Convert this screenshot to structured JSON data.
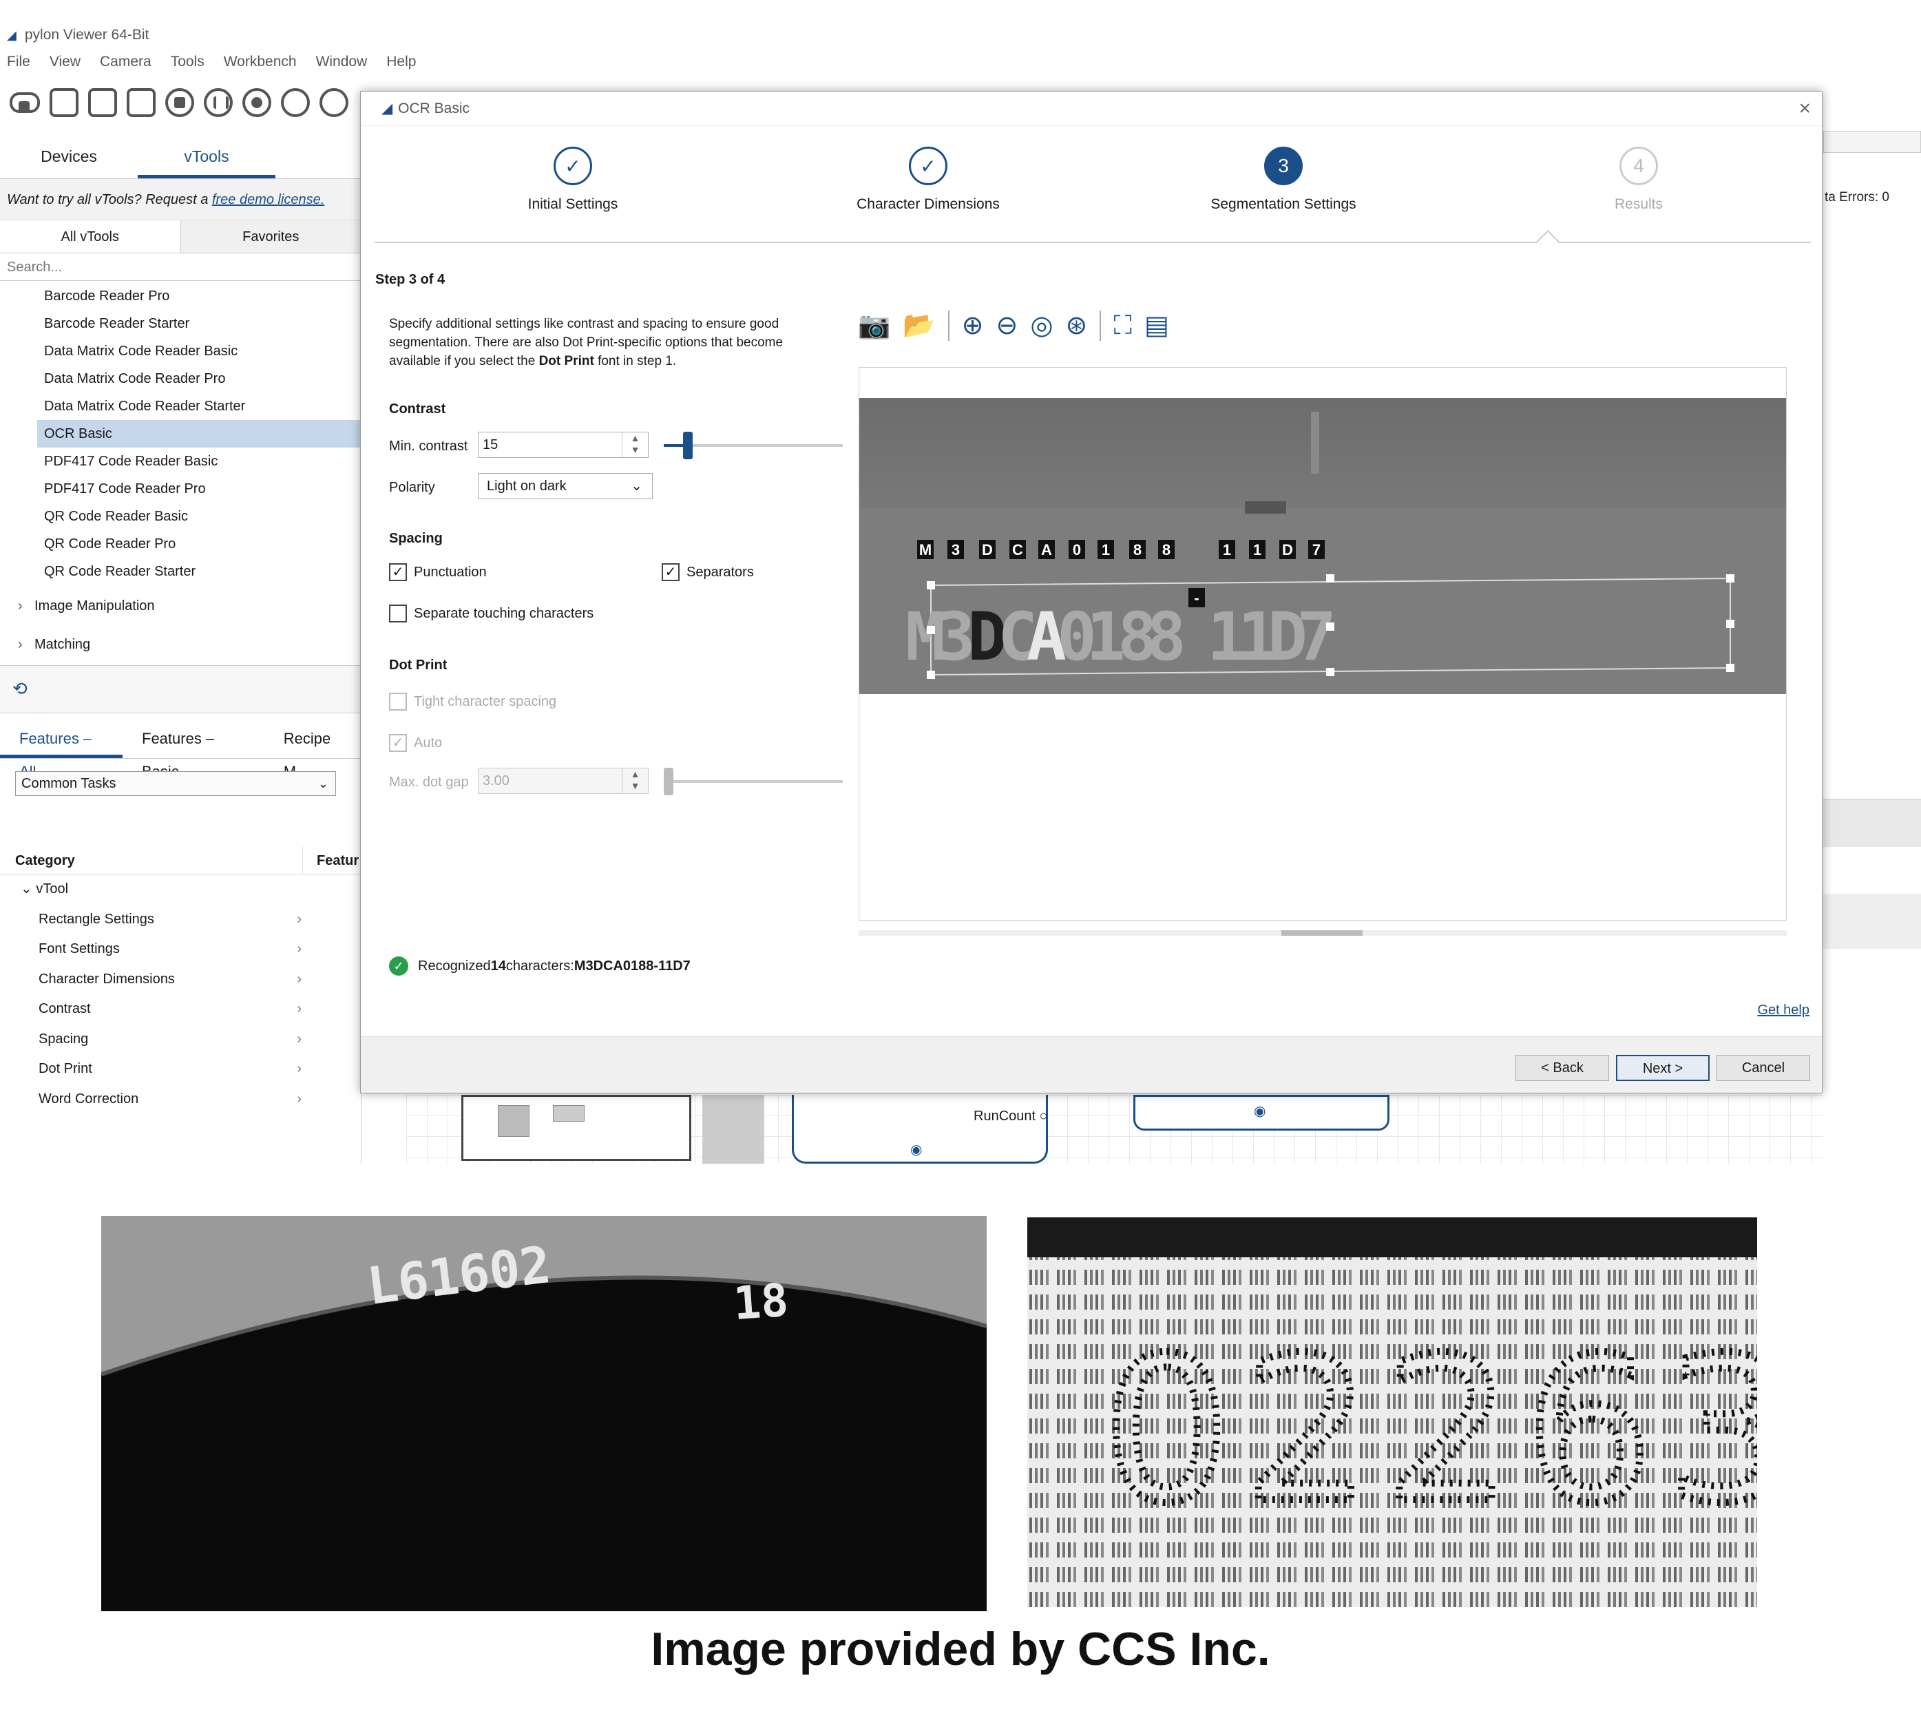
{
  "app": {
    "title": "pylon Viewer 64-Bit",
    "menu": [
      "File",
      "View",
      "Camera",
      "Tools",
      "Workbench",
      "Window",
      "Help"
    ]
  },
  "left_panel": {
    "tabs": [
      "Devices",
      "vTools"
    ],
    "demo_text": "Want to try all vTools? Request a ",
    "demo_link": "free demo license.",
    "subtabs": [
      "All vTools",
      "Favorites"
    ],
    "search_placeholder": "Search...",
    "tools": [
      "Barcode Reader Pro",
      "Barcode Reader Starter",
      "Data Matrix Code Reader Basic",
      "Data Matrix Code Reader Pro",
      "Data Matrix Code Reader Starter",
      "OCR Basic",
      "PDF417 Code Reader Basic",
      "PDF417 Code Reader Pro",
      "QR Code Reader Basic",
      "QR Code Reader Pro",
      "QR Code Reader Starter"
    ],
    "groups": [
      "Image Manipulation",
      "Matching"
    ],
    "feature_tabs": [
      "Features – All",
      "Features – Basic",
      "Recipe M"
    ],
    "features_dropdown": "Common Tasks",
    "category_header": "Category",
    "feature_header": "Featur",
    "categories": [
      "vTool",
      "Rectangle Settings",
      "Font Settings",
      "Character Dimensions",
      "Contrast",
      "Spacing",
      "Dot Print",
      "Word Correction"
    ]
  },
  "background": {
    "right_text": "ta Errors: 0",
    "runcount": "RunCount"
  },
  "dialog": {
    "title": "OCR Basic",
    "steps": [
      {
        "num": "✓",
        "label": "Initial Settings"
      },
      {
        "num": "✓",
        "label": "Character Dimensions"
      },
      {
        "num": "3",
        "label": "Segmentation Settings"
      },
      {
        "num": "4",
        "label": "Results"
      }
    ],
    "step_of": "Step 3 of 4",
    "desc_1": "Specify additional settings like contrast and spacing to ensure good segmentation. There are also Dot Print-specific options that become available if you select the ",
    "desc_bold": "Dot Print",
    "desc_2": " font in step 1.",
    "contrast_header": "Contrast",
    "min_contrast_label": "Min. contrast",
    "min_contrast_value": "15",
    "polarity_label": "Polarity",
    "polarity_value": "Light on dark",
    "spacing_header": "Spacing",
    "punctuation": "Punctuation",
    "separators": "Separators",
    "separate_touching": "Separate touching characters",
    "dotprint_header": "Dot Print",
    "tight_spacing": "Tight character spacing",
    "auto": "Auto",
    "max_dot_gap_label": "Max. dot gap",
    "max_dot_gap_value": "3.00",
    "ocr_labels": [
      "M",
      "3",
      "D",
      "C",
      "A",
      "0",
      "1",
      "8",
      "8",
      "-",
      "1",
      "1",
      "D",
      "7"
    ],
    "recognized_prefix": "Recognized ",
    "recognized_count": "14",
    "recognized_mid": " characters: ",
    "recognized_text": "M3DCA0188-11D7",
    "get_help": "Get help",
    "back": "< Back",
    "next": "Next >",
    "cancel": "Cancel"
  },
  "photos": {
    "photo1_text_a": "L61602",
    "photo1_text_b": "18",
    "photo2_text": "02263"
  },
  "caption": "Image provided by CCS Inc.",
  "colors": {
    "accent": "#1b4f8a",
    "selection": "#c5d7ea",
    "success": "#2a9d4b"
  }
}
